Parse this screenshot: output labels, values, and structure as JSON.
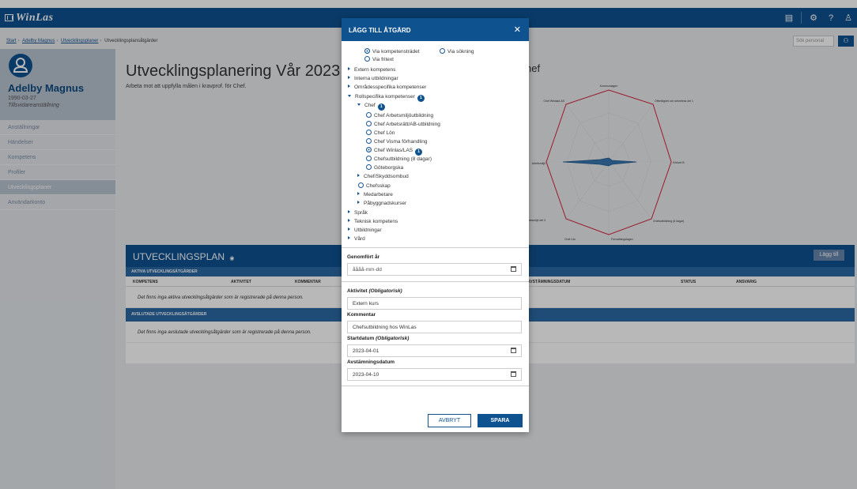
{
  "app": {
    "logo": "WinLas"
  },
  "breadcrumb": {
    "items": [
      "Start",
      "Adelby Magnus",
      "Utvecklingsplaner"
    ],
    "current": "Utvecklingsplansåtgärder"
  },
  "search": {
    "placeholder": "Sök personal"
  },
  "person": {
    "name": "Adelby Magnus",
    "birthdate": "1990-03-27",
    "employment": "Tillsvidareanställning"
  },
  "sidebar": {
    "items": [
      {
        "label": "Anställningar"
      },
      {
        "label": "Händelser"
      },
      {
        "label": "Kompetens"
      },
      {
        "label": "Profiler"
      },
      {
        "label": "Utvecklingsplaner"
      },
      {
        "label": "Användarkonto"
      }
    ]
  },
  "page": {
    "title": "Utvecklingsplanering Vår 2023",
    "subtitle": "Arbeta mot att uppfylla målen i kravprof. för Chef.",
    "chart_title": "hef"
  },
  "radar": {
    "labels": [
      "Kommunlagen",
      "Offentlighet och sekretess del 1",
      "Körkort B",
      "Chefsutbildning (8 dagar)",
      "Förvaltningslagen",
      "Chef Lön",
      "Arbetsmiljö del 3",
      "Arbetsmiljö",
      "Chef Winlas/LAS"
    ]
  },
  "plan": {
    "title": "UTVECKLINGSPLAN",
    "add_label": "Lägg till",
    "active_header": "AKTIVA UTVECKLINGSÅTGÄRDER",
    "columns": [
      "KOMPETENS",
      "AKTIVITET",
      "KOMMENTAR",
      "AVSTÄMNINGSDATUM",
      "STATUS",
      "ANSVARIG"
    ],
    "active_empty": "Det finns inga aktiva utvecklingsåtgärder som är registrerade på denna person.",
    "closed_header": "AVSLUTADE UTVECKLINGSÅTGÄRDER",
    "closed_empty": "Det finns inga avslutade utvecklingsåtgärder som är registrerade på denna person."
  },
  "modal": {
    "title": "LÄGG TILL ÅTGÄRD",
    "close": "✕",
    "source_options": [
      "Via kompetensträdet",
      "Via sökning",
      "Via fritext"
    ],
    "tree": {
      "top": [
        "Extern kompetens",
        "Interna utbildningar",
        "Områdesspecifika kompetenser"
      ],
      "role": "Rollspecifika kompetenser",
      "role_badge": "1",
      "chef": "Chef",
      "chef_badge": "1",
      "chef_items": [
        "Chef Arbetsmiljöutbildning",
        "Chef Arbetsrätt/AB-utbildning",
        "Chef Lön",
        "Chef Visma förhandling",
        "Chef Winlas/LAS",
        "Chefsutbildning (8 dagar)",
        "Göteborgska"
      ],
      "selected_badge": "1",
      "chef_skydd": "Chef/Skyddsombud",
      "chefsskap": "Chefsskap",
      "medarbetare": "Medarbetare",
      "pabyggnad": "Påbyggnadskurser",
      "bottom": [
        "Språk",
        "Teknisk kompetens",
        "Utbildningar",
        "Vård"
      ]
    },
    "completed_label": "Genomfört år",
    "completed_value": "åååå-mm-dd",
    "activity_label": "Aktivitet",
    "required": "(Obligatorisk)",
    "activity_value": "Extern kurs",
    "comment_label": "Kommentar",
    "comment_value": "Chefsutbildning hos WinLas",
    "start_label": "Startdatum",
    "start_value": "2023-04-01",
    "check_label": "Avstämningsdatum",
    "check_value": "2023-04-10",
    "cancel_label": "AVBRYT",
    "save_label": "SPARA"
  }
}
